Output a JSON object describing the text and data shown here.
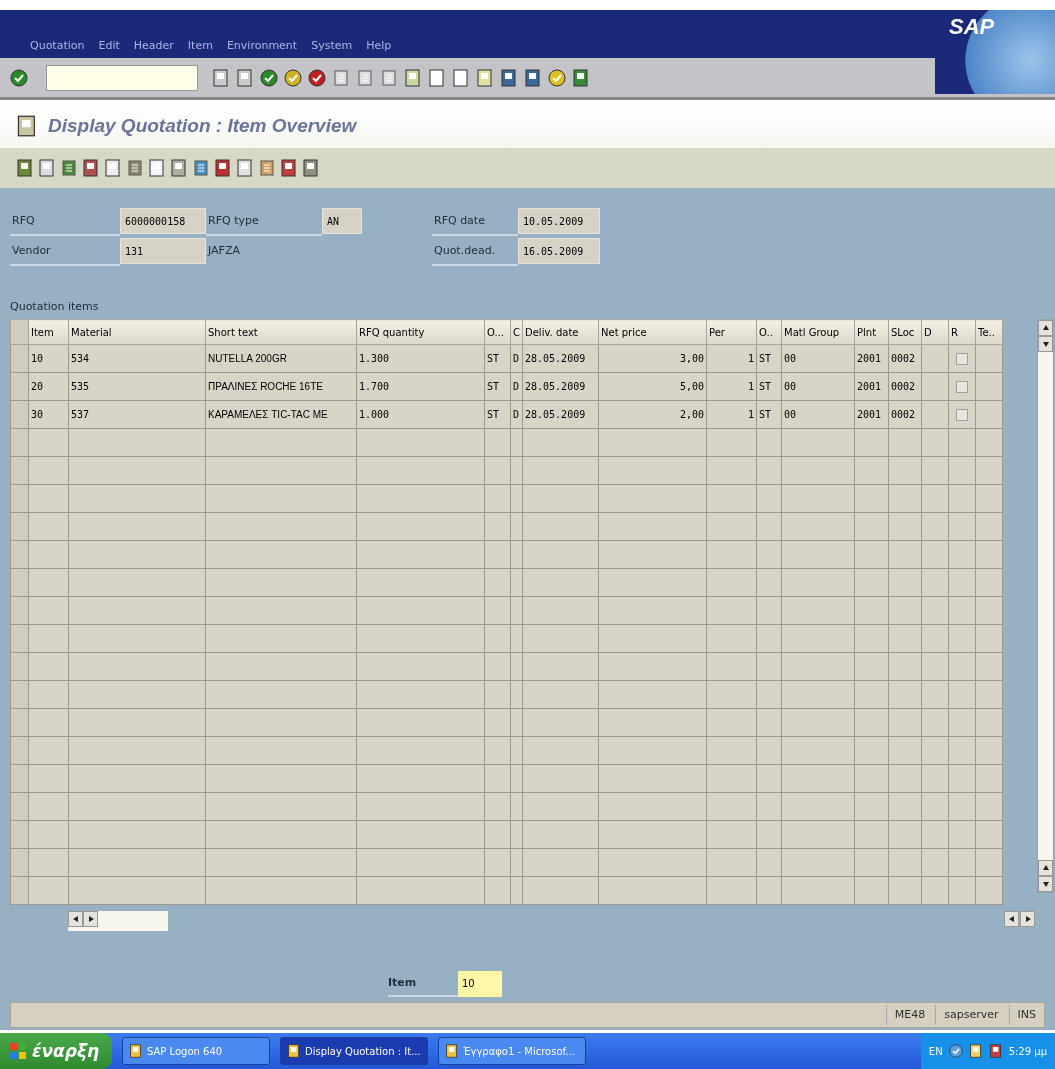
{
  "menu": [
    "Quotation",
    "Edit",
    "Header",
    "Item",
    "Environment",
    "System",
    "Help"
  ],
  "logo": "SAP",
  "title": "Display Quotation : Item Overview",
  "header": {
    "rows": [
      {
        "label": "RFQ",
        "value": "6000000158",
        "label2": "RFQ type",
        "value2": "AN",
        "label3": "RFQ date",
        "value3": "10.05.2009"
      },
      {
        "label": "Vendor",
        "value": "131",
        "text": "JAFZA",
        "label3": "Quot.dead.",
        "value3": "16.05.2009"
      }
    ]
  },
  "table": {
    "label": "Quotation items",
    "columns": [
      "Item",
      "Material",
      "Short text",
      "RFQ quantity",
      "O...",
      "C",
      "Deliv. date",
      "Net price",
      "Per",
      "O..",
      "Matl Group",
      "Plnt",
      "SLoc",
      "D",
      "R",
      "Te.."
    ],
    "rows": [
      {
        "item": "10",
        "material": "534",
        "short_text": "NUTELLA 200GR",
        "quantity": "1.300",
        "unit": "ST",
        "c": "D",
        "date": "28.05.2009",
        "price": "3,00",
        "per": "1",
        "order_unit": "ST",
        "group": "00",
        "plant": "2001",
        "sloc": "0002",
        "checked": false
      },
      {
        "item": "20",
        "material": "535",
        "short_text": "ΠΡΑΛΙΝΕΣ ROCHE 16TE",
        "quantity": "1.700",
        "unit": "ST",
        "c": "D",
        "date": "28.05.2009",
        "price": "5,00",
        "per": "1",
        "order_unit": "ST",
        "group": "00",
        "plant": "2001",
        "sloc": "0002",
        "checked": false
      },
      {
        "item": "30",
        "material": "537",
        "short_text": "ΚΑΡΑΜΕΛΕΣ TIC-TAC ME",
        "quantity": "1.000",
        "unit": "ST",
        "c": "D",
        "date": "28.05.2009",
        "price": "2,00",
        "per": "1",
        "order_unit": "ST",
        "group": "00",
        "plant": "2001",
        "sloc": "0002",
        "checked": false
      }
    ]
  },
  "item_field": {
    "label": "Item",
    "value": "10"
  },
  "status_bar": {
    "transaction": "ME48",
    "server": "sapserver",
    "mode": "INS"
  },
  "taskbar": {
    "start": "έναρξη",
    "tasks": [
      {
        "label": "SAP Logon 640",
        "selected": false
      },
      {
        "label": "Display Quotation : It...",
        "selected": true
      },
      {
        "label": "Έγγραφο1 - Microsof...",
        "selected": false
      }
    ],
    "language": "EN",
    "clock": "5:29 μμ"
  }
}
